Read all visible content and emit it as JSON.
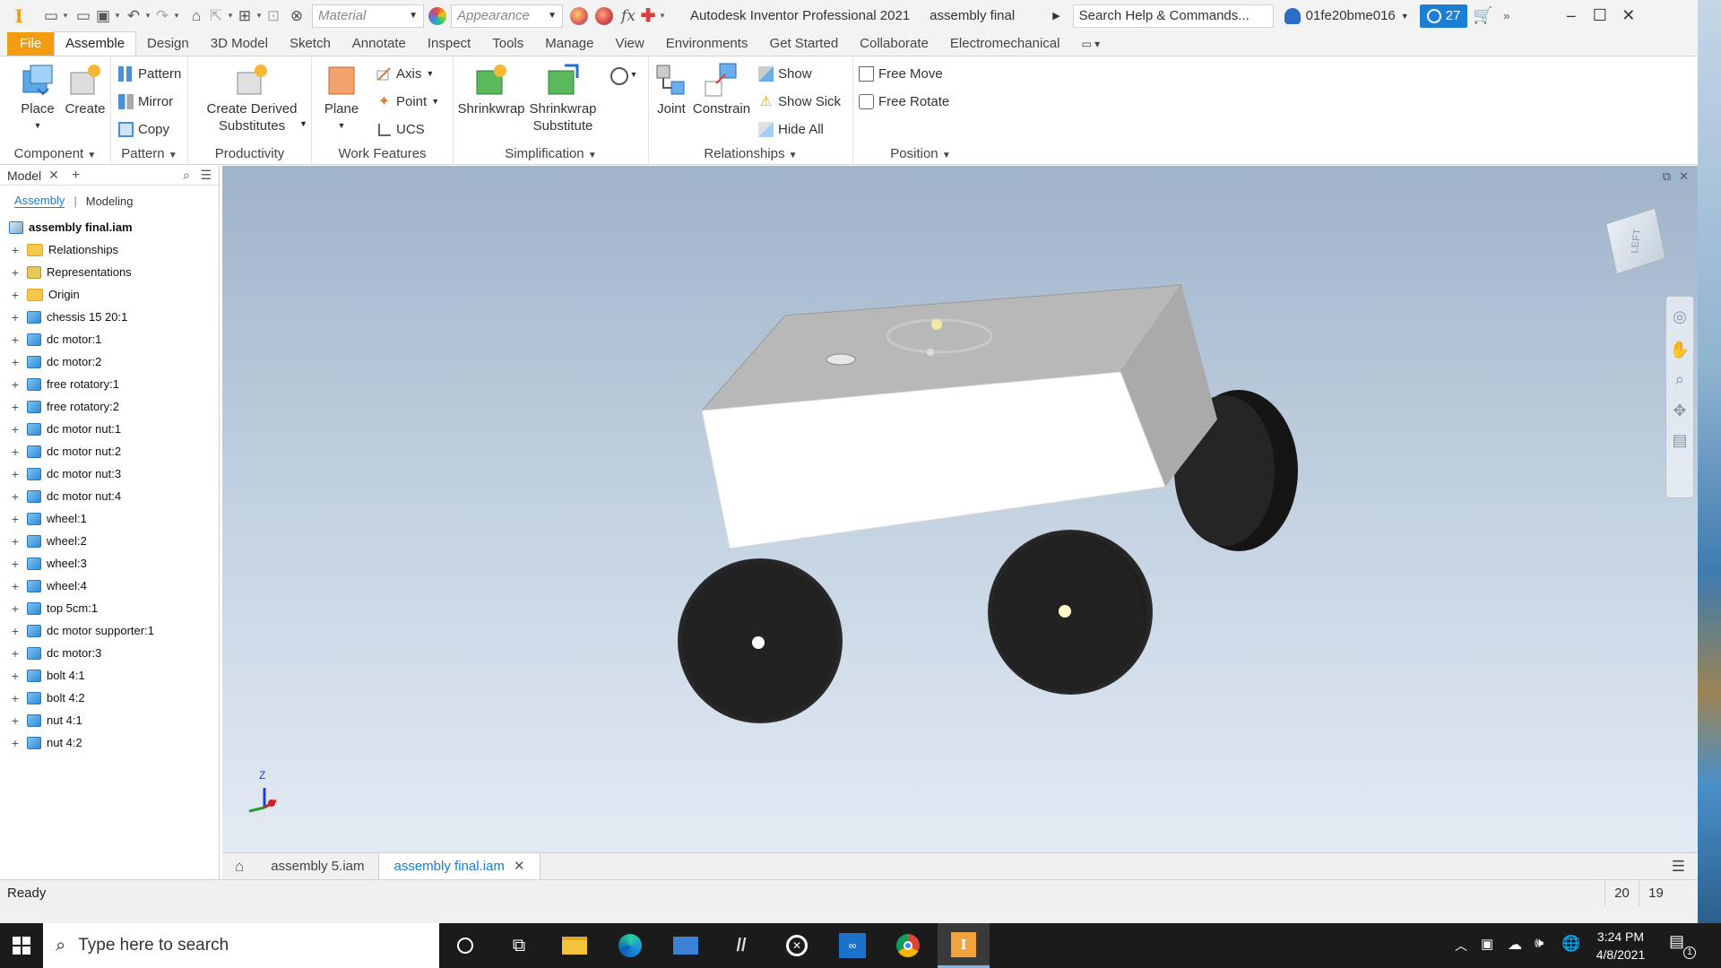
{
  "titlebar": {
    "material_placeholder": "Material",
    "appearance_placeholder": "Appearance",
    "app_title": "Autodesk Inventor Professional 2021",
    "doc_title": "assembly final",
    "search_placeholder": "Search Help & Commands...",
    "user": "01fe20bme016",
    "notifications": "27"
  },
  "ribbon_tabs": [
    "File",
    "Assemble",
    "Design",
    "3D Model",
    "Sketch",
    "Annotate",
    "Inspect",
    "Tools",
    "Manage",
    "View",
    "Environments",
    "Get Started",
    "Collaborate",
    "Electromechanical"
  ],
  "ribbon": {
    "component": {
      "title": "Component",
      "place": "Place",
      "create": "Create"
    },
    "pattern": {
      "title": "Pattern",
      "pattern": "Pattern",
      "mirror": "Mirror",
      "copy": "Copy"
    },
    "productivity": {
      "title": "Productivity",
      "create_derived_1": "Create Derived",
      "create_derived_2": "Substitutes"
    },
    "work_features": {
      "title": "Work Features",
      "plane": "Plane",
      "axis": "Axis",
      "point": "Point",
      "ucs": "UCS"
    },
    "simplification": {
      "title": "Simplification",
      "shrinkwrap": "Shrinkwrap",
      "shrinkwrap_sub_1": "Shrinkwrap",
      "shrinkwrap_sub_2": "Substitute"
    },
    "relationships": {
      "title": "Relationships",
      "joint": "Joint",
      "constrain": "Constrain",
      "show": "Show",
      "show_sick": "Show Sick",
      "hide_all": "Hide All"
    },
    "position": {
      "title": "Position",
      "free_move": "Free Move",
      "free_rotate": "Free Rotate"
    }
  },
  "browser": {
    "title": "Model",
    "tab_assembly": "Assembly",
    "tab_modeling": "Modeling",
    "root": "assembly final.iam",
    "items": [
      {
        "label": "Relationships",
        "icon": "folder"
      },
      {
        "label": "Representations",
        "icon": "representations"
      },
      {
        "label": "Origin",
        "icon": "folder"
      },
      {
        "label": "chessis 15 20:1",
        "icon": "part"
      },
      {
        "label": "dc motor:1",
        "icon": "part"
      },
      {
        "label": "dc motor:2",
        "icon": "part"
      },
      {
        "label": "free rotatory:1",
        "icon": "part"
      },
      {
        "label": "free rotatory:2",
        "icon": "part"
      },
      {
        "label": "dc motor nut:1",
        "icon": "part"
      },
      {
        "label": "dc motor nut:2",
        "icon": "part"
      },
      {
        "label": "dc motor nut:3",
        "icon": "part"
      },
      {
        "label": "dc motor nut:4",
        "icon": "part"
      },
      {
        "label": "wheel:1",
        "icon": "part"
      },
      {
        "label": "wheel:2",
        "icon": "part"
      },
      {
        "label": "wheel:3",
        "icon": "part"
      },
      {
        "label": "wheel:4",
        "icon": "part"
      },
      {
        "label": "top 5cm:1",
        "icon": "part"
      },
      {
        "label": "dc motor supporter:1",
        "icon": "sheetmetal"
      },
      {
        "label": "dc motor:3",
        "icon": "part"
      },
      {
        "label": "bolt 4:1",
        "icon": "part"
      },
      {
        "label": "bolt 4:2",
        "icon": "part"
      },
      {
        "label": "nut 4:1",
        "icon": "part"
      },
      {
        "label": "nut 4:2",
        "icon": "part"
      }
    ]
  },
  "viewcube_face": "LEFT",
  "doc_tabs": [
    "assembly 5.iam",
    "assembly final.iam"
  ],
  "status": {
    "text": "Ready",
    "num1": "20",
    "num2": "19"
  },
  "taskbar": {
    "search_placeholder": "Type here to search",
    "time": "3:24 PM",
    "date": "4/8/2021",
    "notification_count": "1"
  },
  "colors": {
    "file_tab": "#f39c12",
    "accent_blue": "#1a7ed6",
    "viewport_top": "#9fb3c9",
    "viewport_bottom": "#e3ebf4"
  }
}
